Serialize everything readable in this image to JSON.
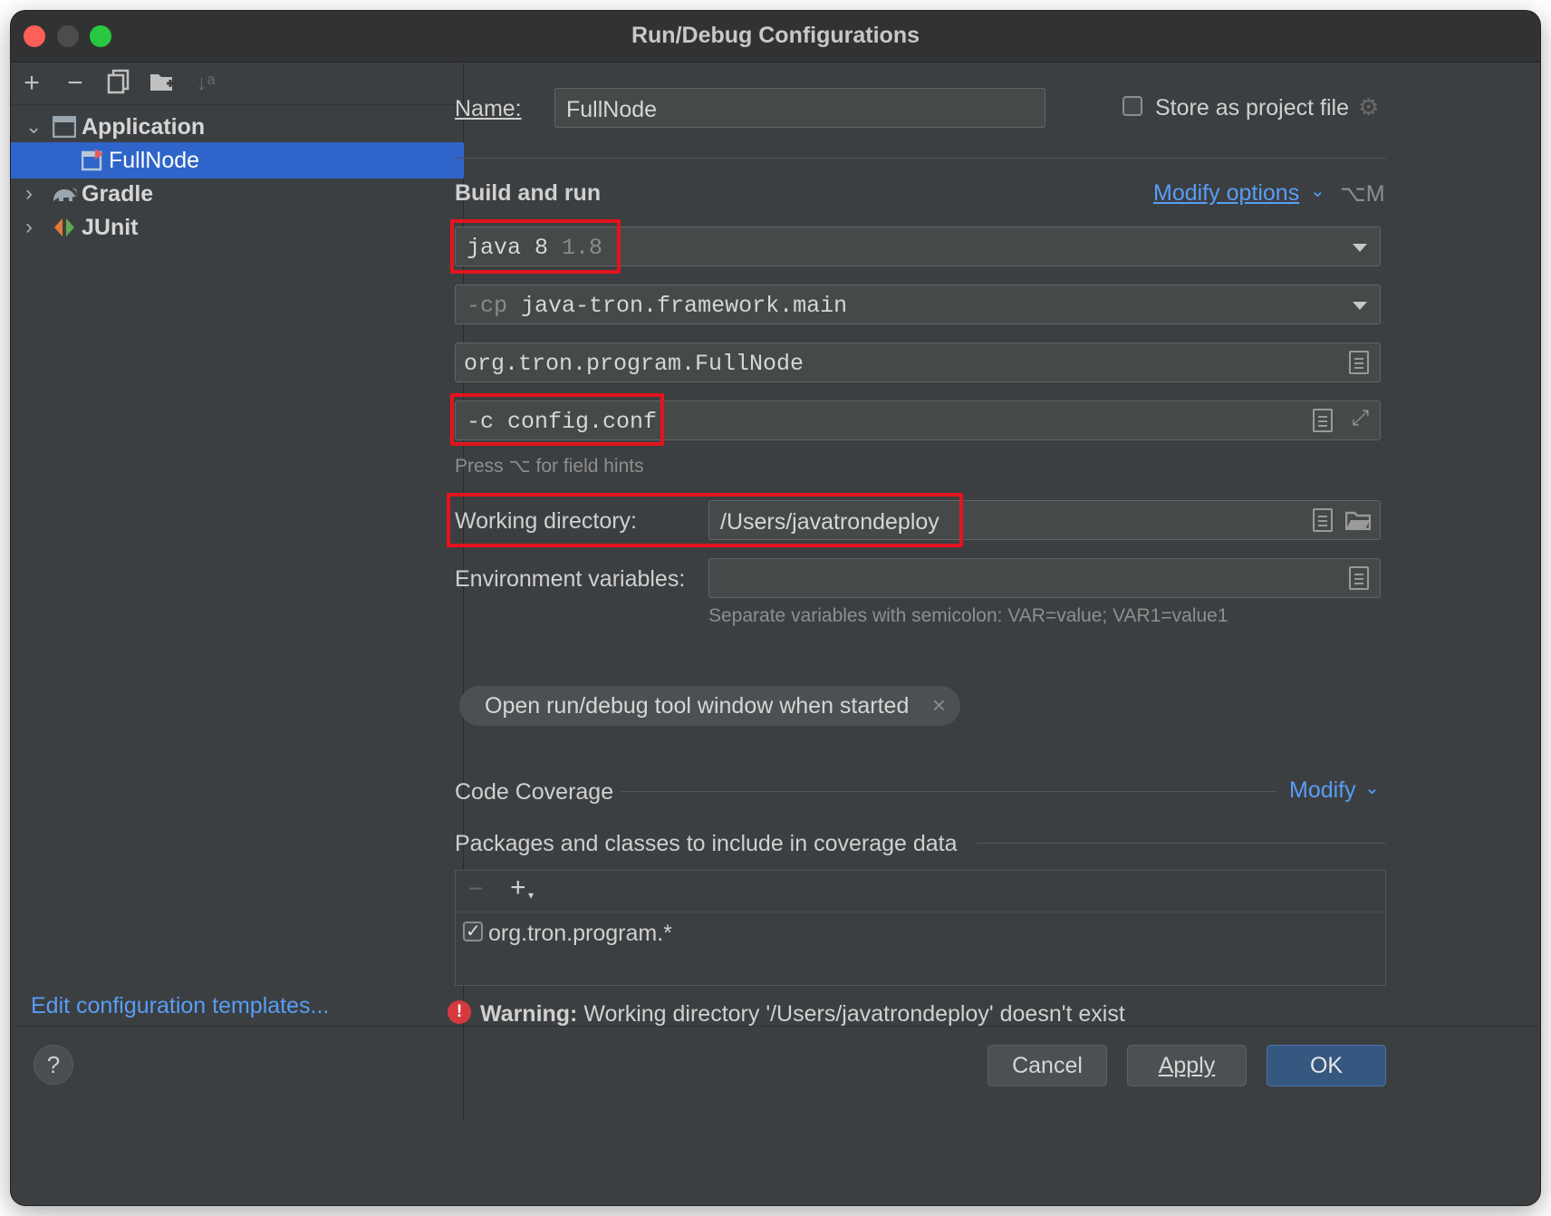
{
  "window": {
    "title": "Run/Debug Configurations"
  },
  "sidebar": {
    "toolbar": {
      "add": "+",
      "remove": "−"
    },
    "tree": [
      {
        "label": "Application",
        "icon": "application-icon",
        "expanded": true
      },
      {
        "label": "FullNode",
        "icon": "run-config-icon",
        "selected": true
      },
      {
        "label": "Gradle",
        "icon": "gradle-elephant-icon",
        "expanded": false
      },
      {
        "label": "JUnit",
        "icon": "junit-icon",
        "expanded": false
      }
    ],
    "edit_templates_link": "Edit configuration templates..."
  },
  "config": {
    "name_label": "Name:",
    "name_value": "FullNode",
    "store_as_project_file": "Store as project file",
    "store_checked": false,
    "section_build_run": "Build and run",
    "modify_options": "Modify options",
    "modify_options_shortcut": "⌥M",
    "jdk": {
      "name": "java 8",
      "version": "1.8"
    },
    "classpath": {
      "prefix": "-cp",
      "module": "java-tron.framework.main"
    },
    "main_class": "org.tron.program.FullNode",
    "program_args": "-c config.conf",
    "field_hint": "Press ⌥ for field hints",
    "working_dir_label": "Working directory:",
    "working_dir_value": "/Users/javatrondeploy",
    "env_label": "Environment variables:",
    "env_value": "",
    "env_hint": "Separate variables with semicolon: VAR=value; VAR1=value1",
    "chip_label": "Open run/debug tool window when started",
    "coverage_label": "Code Coverage",
    "coverage_modify": "Modify",
    "packages_label": "Packages and classes to include in coverage data",
    "packages": [
      {
        "pattern": "org.tron.program.*",
        "checked": true
      }
    ]
  },
  "warning": {
    "bold": "Warning:",
    "text": "Working directory '/Users/javatrondeploy' doesn't exist"
  },
  "buttons": {
    "help": "?",
    "cancel": "Cancel",
    "apply": "Apply",
    "ok": "OK"
  },
  "colors": {
    "accent": "#2f65ca",
    "link": "#589df6",
    "highlight": "#e3141f",
    "warning": "#d5393e"
  }
}
